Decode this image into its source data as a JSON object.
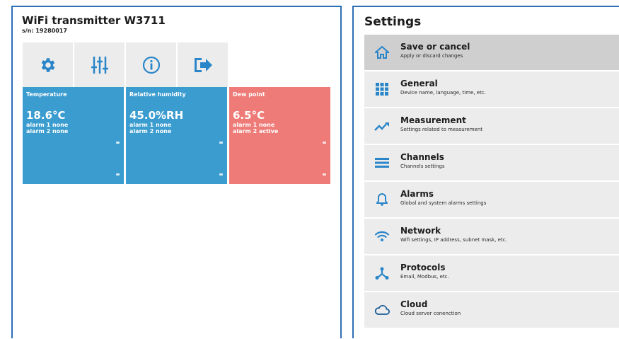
{
  "device": {
    "title": "WiFi transmitter W3711",
    "serial": "s/n: 19280017"
  },
  "toolbar": {
    "buttons": [
      {
        "icon": "gear-icon"
      },
      {
        "icon": "sliders-icon"
      },
      {
        "icon": "info-icon"
      },
      {
        "icon": "logout-icon"
      }
    ]
  },
  "tiles": [
    {
      "name": "Temperature",
      "value": "18.6°C",
      "alarm1": "alarm 1 none",
      "alarm2": "alarm 2 none",
      "color": "#3a9ccf"
    },
    {
      "name": "Relative humidity",
      "value": "45.0%RH",
      "alarm1": "alarm 1 none",
      "alarm2": "alarm 2 none",
      "color": "#3a9ccf"
    },
    {
      "name": "Dew point",
      "value": "6.5°C",
      "alarm1": "alarm 1 none",
      "alarm2": "alarm 2 active",
      "color": "#ee7b78"
    }
  ],
  "settings": {
    "title": "Settings",
    "items": [
      {
        "label": "Save or cancel",
        "desc": "Apply or discard changes",
        "icon": "home-icon"
      },
      {
        "label": "General",
        "desc": "Device name, language, time, etc.",
        "icon": "grid-icon"
      },
      {
        "label": "Measurement",
        "desc": "Settings related to measurement",
        "icon": "trend-icon"
      },
      {
        "label": "Channels",
        "desc": "Channels settings",
        "icon": "list-icon"
      },
      {
        "label": "Alarms",
        "desc": "Global and system alarms settings",
        "icon": "bell-icon"
      },
      {
        "label": "Network",
        "desc": "Wifi settings, IP address, subnet mask, etc.",
        "icon": "wifi-icon"
      },
      {
        "label": "Protocols",
        "desc": "Email, Modbus, etc.",
        "icon": "network-icon"
      },
      {
        "label": "Cloud",
        "desc": "Cloud server conenction",
        "icon": "cloud-icon"
      }
    ]
  },
  "colors": {
    "border": "#2e6eb5",
    "icon_blue": "#2a86c9",
    "tile_blue": "#3a9ccf",
    "tile_red": "#ee7b78"
  }
}
